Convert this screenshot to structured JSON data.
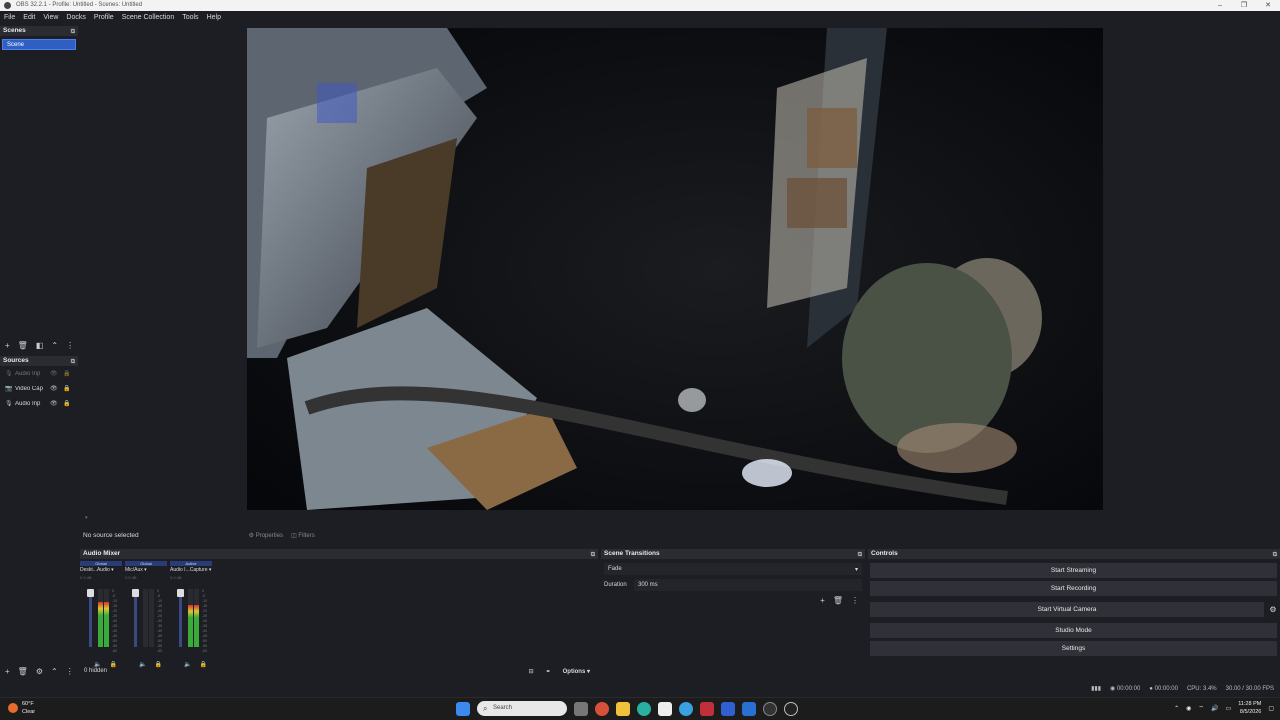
{
  "window": {
    "title": "OBS 32.2.1 - Profile: Untitled - Scenes: Untitled",
    "controls": [
      "–",
      "❐",
      "✕"
    ]
  },
  "menu": [
    "File",
    "Edit",
    "View",
    "Docks",
    "Profile",
    "Scene Collection",
    "Tools",
    "Help"
  ],
  "scenes": {
    "title": "Scenes",
    "items": [
      "Scene"
    ]
  },
  "sources": {
    "title": "Sources",
    "items": [
      {
        "label": "Audio Inp",
        "icon": "mic-icon",
        "hidden": true
      },
      {
        "label": "Video Cap",
        "icon": "camera-icon",
        "hidden": false
      },
      {
        "label": "Audio Inp",
        "icon": "mic-icon",
        "hidden": false
      }
    ]
  },
  "context": {
    "no_source": "No source selected",
    "properties": "Properties",
    "filters": "Filters"
  },
  "mixer": {
    "title": "Audio Mixer",
    "channels": [
      {
        "tag": "Global",
        "name": "Deskt...Audio",
        "db": "0.0 dB",
        "level": 0.78,
        "muted": false
      },
      {
        "tag": "Global",
        "name": "Mic/Aux",
        "db": "0.0 dB",
        "level": 0.0,
        "muted": false
      },
      {
        "tag": "Active",
        "name": "Audio I...Capture",
        "db": "0.0 dB",
        "level": 0.72,
        "muted": false
      }
    ],
    "scale": [
      "0",
      "-5",
      "-10",
      "-15",
      "-20",
      "-25",
      "-30",
      "-35",
      "-40",
      "-45",
      "-50",
      "-55",
      "-60"
    ],
    "hidden_count": "0 hidden",
    "options": "Options"
  },
  "transitions": {
    "title": "Scene Transitions",
    "selected": "Fade",
    "duration_label": "Duration",
    "duration_value": "300 ms"
  },
  "controls": {
    "title": "Controls",
    "buttons": [
      "Start Streaming",
      "Start Recording",
      "Start Virtual Camera",
      "Studio Mode",
      "Settings"
    ]
  },
  "status": {
    "stream_time": "00:00:00",
    "rec_time": "00:00:00",
    "cpu": "CPU: 3.4%",
    "fps": "30.00 / 30.00 FPS"
  },
  "taskbar": {
    "temp": "60°F",
    "weather": "Clear",
    "search_placeholder": "Search",
    "time": "11:28 PM",
    "date": "8/5/2026"
  },
  "colors": {
    "accent": "#2f5fc2",
    "panel": "#1d1e23",
    "button": "#303138"
  }
}
